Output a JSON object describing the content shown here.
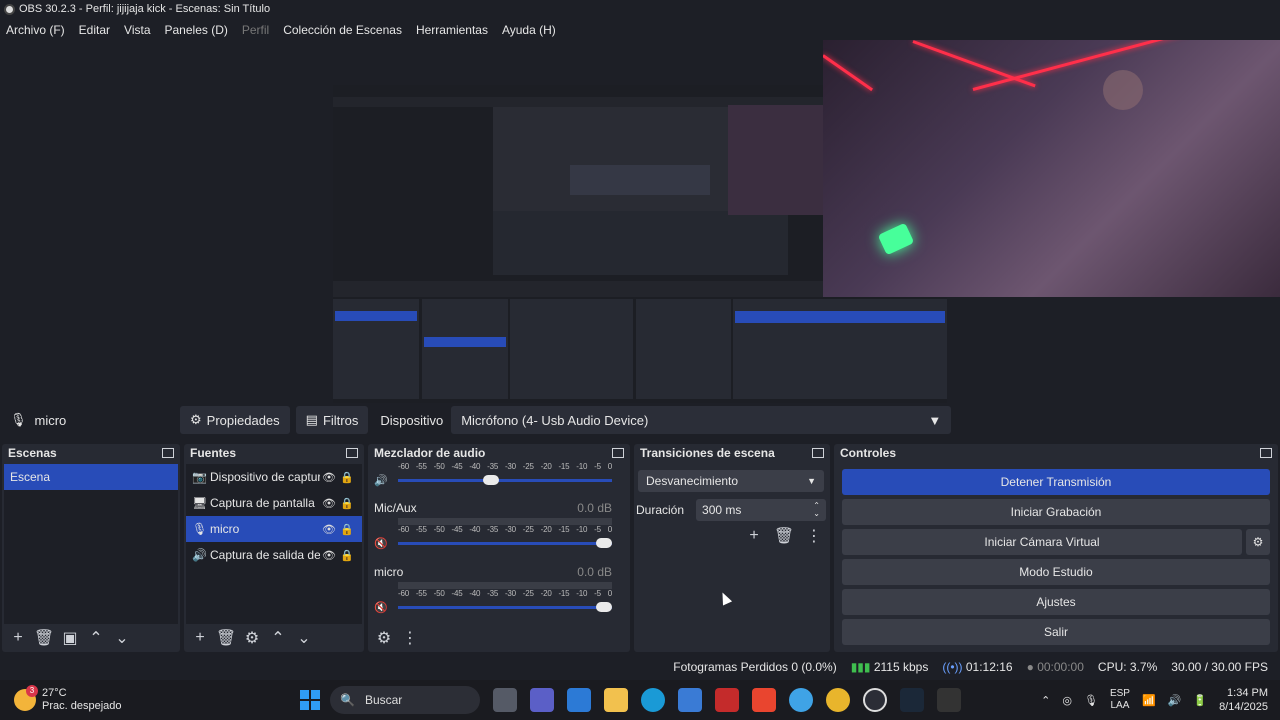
{
  "window": {
    "title": "OBS 30.2.3 - Perfil: jijijaja kick - Escenas: Sin Título"
  },
  "menu": [
    "Archivo (F)",
    "Editar",
    "Vista",
    "Paneles (D)",
    "Perfil",
    "Colección de Escenas",
    "Herramientas",
    "Ayuda (H)"
  ],
  "source_bar": {
    "selected_source": "micro",
    "properties_label": "Propiedades",
    "filters_label": "Filtros",
    "device_label": "Dispositivo",
    "device_value": "Micrófono (4- Usb Audio Device)"
  },
  "scenes": {
    "title": "Escenas",
    "items": [
      "Escena"
    ]
  },
  "sources": {
    "title": "Fuentes",
    "items": [
      {
        "name": "Dispositivo de captur",
        "icon": "camera-icon"
      },
      {
        "name": "Captura de pantalla",
        "icon": "monitor-icon"
      },
      {
        "name": "micro",
        "icon": "microphone-icon"
      },
      {
        "name": "Captura de salida de",
        "icon": "speaker-icon"
      }
    ]
  },
  "mixer": {
    "title": "Mezclador de audio",
    "scale": [
      "-60",
      "-55",
      "-50",
      "-45",
      "-40",
      "-35",
      "-30",
      "-25",
      "-20",
      "-15",
      "-10",
      "-5",
      "0"
    ],
    "tracks": [
      {
        "name": "",
        "db": "",
        "level": 0.47
      },
      {
        "name": "Mic/Aux",
        "db": "0.0 dB",
        "level": 1.0
      },
      {
        "name": "micro",
        "db": "0.0 dB",
        "level": 1.0
      }
    ]
  },
  "transitions": {
    "title": "Transiciones de escena",
    "selected": "Desvanecimiento",
    "duration_label": "Duración",
    "duration_value": "300 ms"
  },
  "controls": {
    "title": "Controles",
    "stop_stream": "Detener Transmisión",
    "start_recording": "Iniciar Grabación",
    "start_virtual_cam": "Iniciar Cámara Virtual",
    "studio_mode": "Modo Estudio",
    "settings": "Ajustes",
    "exit": "Salir"
  },
  "status": {
    "dropped_frames": "Fotogramas Perdidos 0 (0.0%)",
    "bitrate": "2115 kbps",
    "stream_time": "01:12:16",
    "record_time": "00:00:00",
    "cpu": "CPU: 3.7%",
    "fps": "30.00 / 30.00 FPS"
  },
  "taskbar": {
    "temperature": "27°C",
    "weather": "Prac. despejado",
    "weather_badge": "3",
    "search_placeholder": "Buscar",
    "lang_1": "ESP",
    "lang_2": "LAA",
    "time": "1:34 PM",
    "date": "8/14/2025"
  },
  "colors": {
    "accent": "#284cb8",
    "panel": "#272a33",
    "background": "#1d1f26"
  }
}
